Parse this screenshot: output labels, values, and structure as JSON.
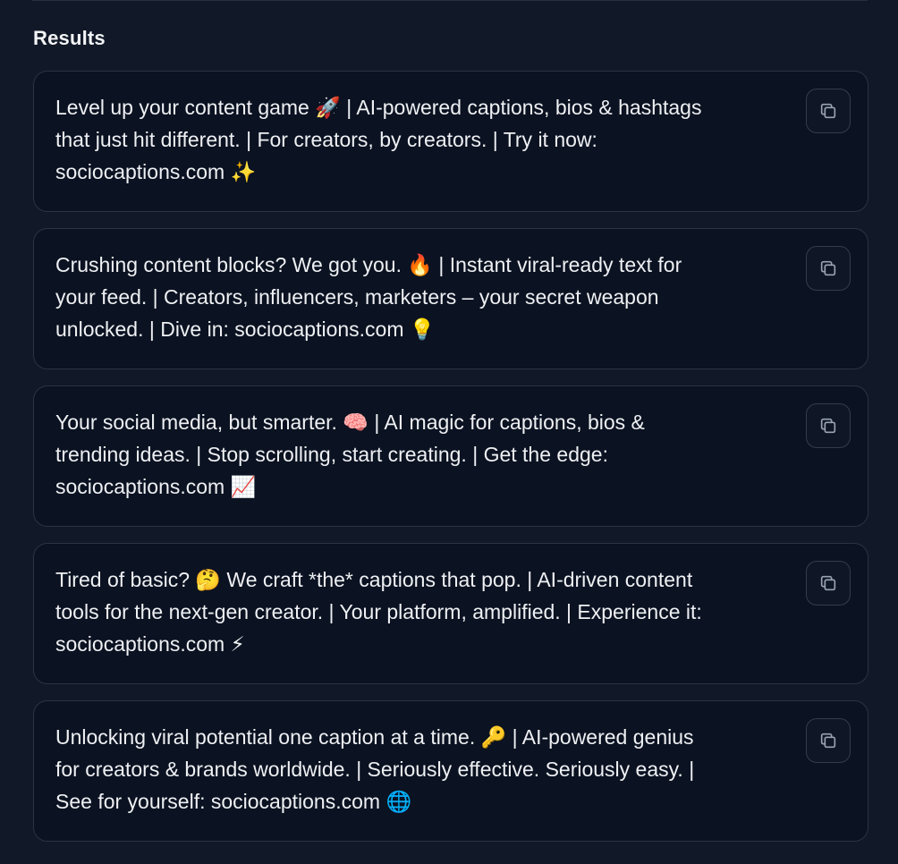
{
  "results": {
    "heading": "Results",
    "copy_icon": "copy-icon",
    "items": [
      {
        "text": "Level up your content game 🚀 | AI-powered captions, bios & hashtags\nthat just hit different. | For creators, by creators. | Try it now:\nsociocaptions.com ✨"
      },
      {
        "text": "Crushing content blocks? We got you. 🔥 | Instant viral-ready text for\nyour feed. | Creators, influencers, marketers – your secret weapon\nunlocked. | Dive in: sociocaptions.com 💡"
      },
      {
        "text": "Your social media, but smarter. 🧠 | AI magic for captions, bios &\ntrending ideas. | Stop scrolling, start creating. | Get the edge:\nsociocaptions.com 📈"
      },
      {
        "text": "Tired of basic? 🤔 We craft *the* captions that pop. | AI-driven content\ntools for the next-gen creator. | Your platform, amplified. | Experience it:\nsociocaptions.com ⚡"
      },
      {
        "text": "Unlocking viral potential one caption at a time. 🔑 | AI-powered genius\nfor creators & brands worldwide. | Seriously effective. Seriously easy. |\nSee for yourself: sociocaptions.com 🌐"
      }
    ]
  }
}
